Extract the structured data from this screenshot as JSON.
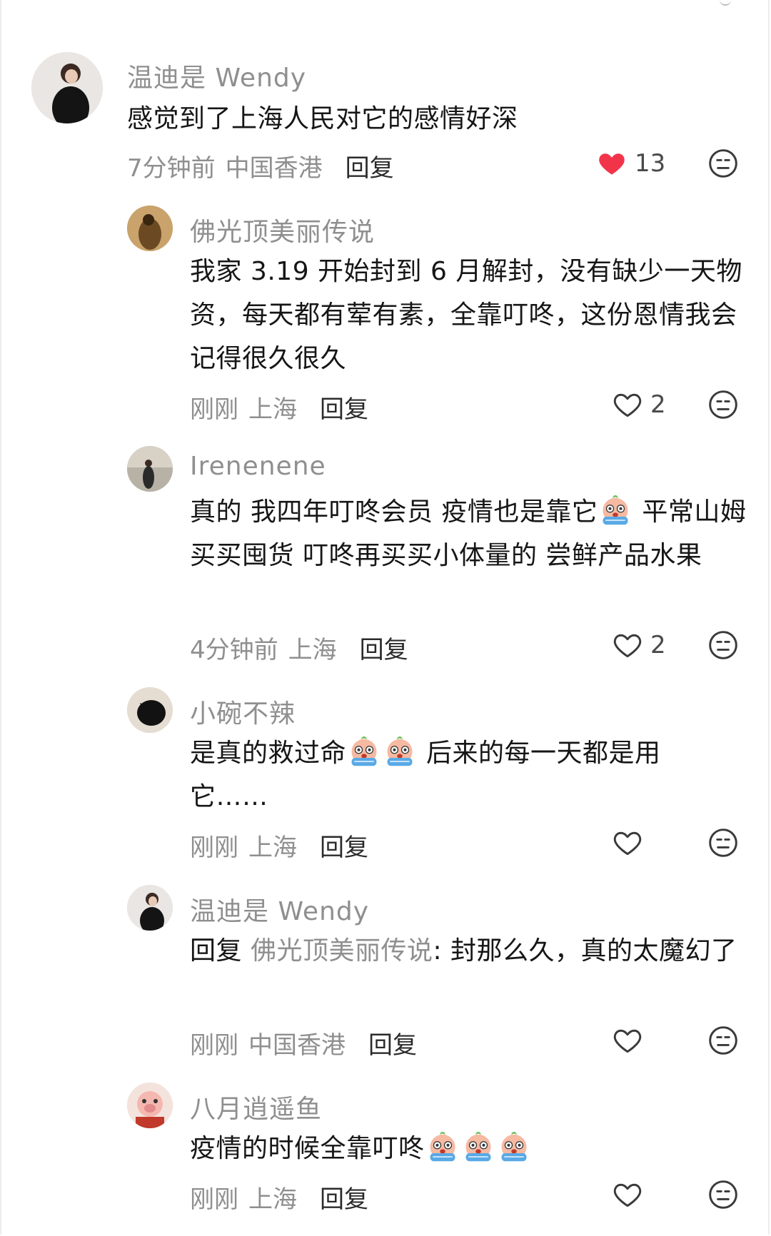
{
  "comments": [
    {
      "username": "温迪是 Wendy",
      "body": "感觉到了上海人民对它的感情好深",
      "time": "7分钟前",
      "location": "中国香港",
      "reply": "回复",
      "likes": "13",
      "liked": true
    },
    {
      "username": "佛光顶美丽传说",
      "body": "我家 3.19 开始封到 6 月解封，没有缺少一天物资，每天都有荤有素，全靠叮咚，这份恩情我会记得很久很久",
      "time": "刚刚",
      "location": "上海",
      "reply": "回复",
      "likes": "2"
    },
    {
      "username": "Irenenene",
      "body_part1": "真的 我四年叮咚会员 疫情也是靠它",
      "body_part2": " 平常山姆买买囤货 叮咚再买买小体量的 尝鲜产品水果",
      "time": "4分钟前",
      "location": "上海",
      "reply": "回复",
      "likes": "2"
    },
    {
      "username": "小碗不辣",
      "body_part1": "是真的救过命",
      "body_part2": " 后来的每一天都是用它……",
      "time": "刚刚",
      "location": "上海",
      "reply": "回复"
    },
    {
      "username": "温迪是 Wendy",
      "reply_prefix": "回复 ",
      "reply_to": "佛光顶美丽传说",
      "body": ": 封那么久，真的太魔幻了",
      "time": "刚刚",
      "location": "中国香港",
      "reply": "回复"
    },
    {
      "username": "八月逍遥鱼",
      "body": "疫情的时候全靠叮咚",
      "time": "刚刚",
      "location": "上海",
      "reply": "回复"
    }
  ],
  "icons": {
    "like": "heart-icon",
    "dislike": "unhappy-face-icon",
    "emoji": "crying-face-emoji"
  },
  "colors": {
    "liked_heart": "#f2344a",
    "muted_text": "#8f8f8f"
  }
}
